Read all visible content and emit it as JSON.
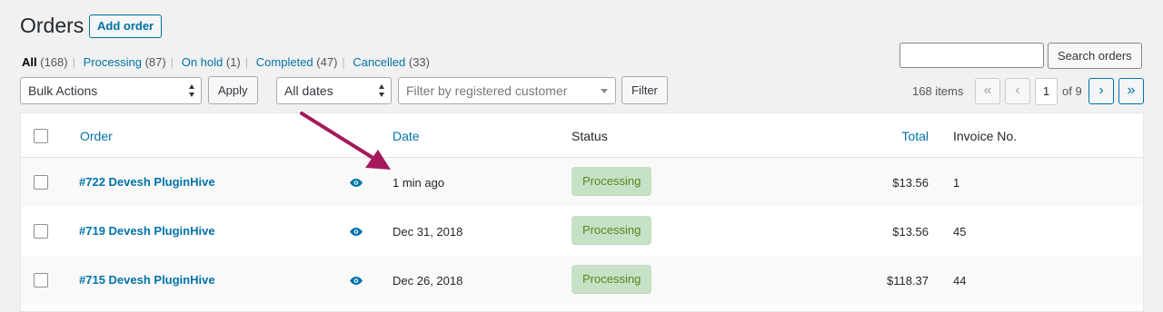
{
  "header": {
    "title": "Orders",
    "add_label": "Add order"
  },
  "views": [
    {
      "label": "All",
      "count": "(168)"
    },
    {
      "label": "Processing",
      "count": "(87)"
    },
    {
      "label": "On hold",
      "count": "(1)"
    },
    {
      "label": "Completed",
      "count": "(47)"
    },
    {
      "label": "Cancelled",
      "count": "(33)"
    }
  ],
  "search": {
    "button_label": "Search orders",
    "value": ""
  },
  "toolbar": {
    "bulk_actions": "Bulk Actions",
    "apply_label": "Apply",
    "dates": "All dates",
    "customer_placeholder": "Filter by registered customer",
    "filter_label": "Filter"
  },
  "pagination": {
    "items": "168 items",
    "first": "«",
    "prev": "‹",
    "current": "1",
    "of": "of 9",
    "next": "›",
    "last": "»"
  },
  "table": {
    "columns": {
      "order": "Order",
      "date": "Date",
      "status": "Status",
      "total": "Total",
      "invoice": "Invoice No."
    },
    "rows": [
      {
        "order": "#722 Devesh PluginHive",
        "date": "1 min ago",
        "status": "Processing",
        "total": "$13.56",
        "invoice": "1"
      },
      {
        "order": "#719 Devesh PluginHive",
        "date": "Dec 31, 2018",
        "status": "Processing",
        "total": "$13.56",
        "invoice": "45"
      },
      {
        "order": "#715 Devesh PluginHive",
        "date": "Dec 26, 2018",
        "status": "Processing",
        "total": "$118.37",
        "invoice": "44"
      }
    ]
  },
  "colors": {
    "link": "#0073aa",
    "status_processing_bg": "#c6e1c6",
    "status_processing_text": "#5b841b",
    "annotation_arrow": "#a3195b"
  },
  "icons": {
    "preview": "eye-icon",
    "annotation": "arrow-annotation"
  }
}
